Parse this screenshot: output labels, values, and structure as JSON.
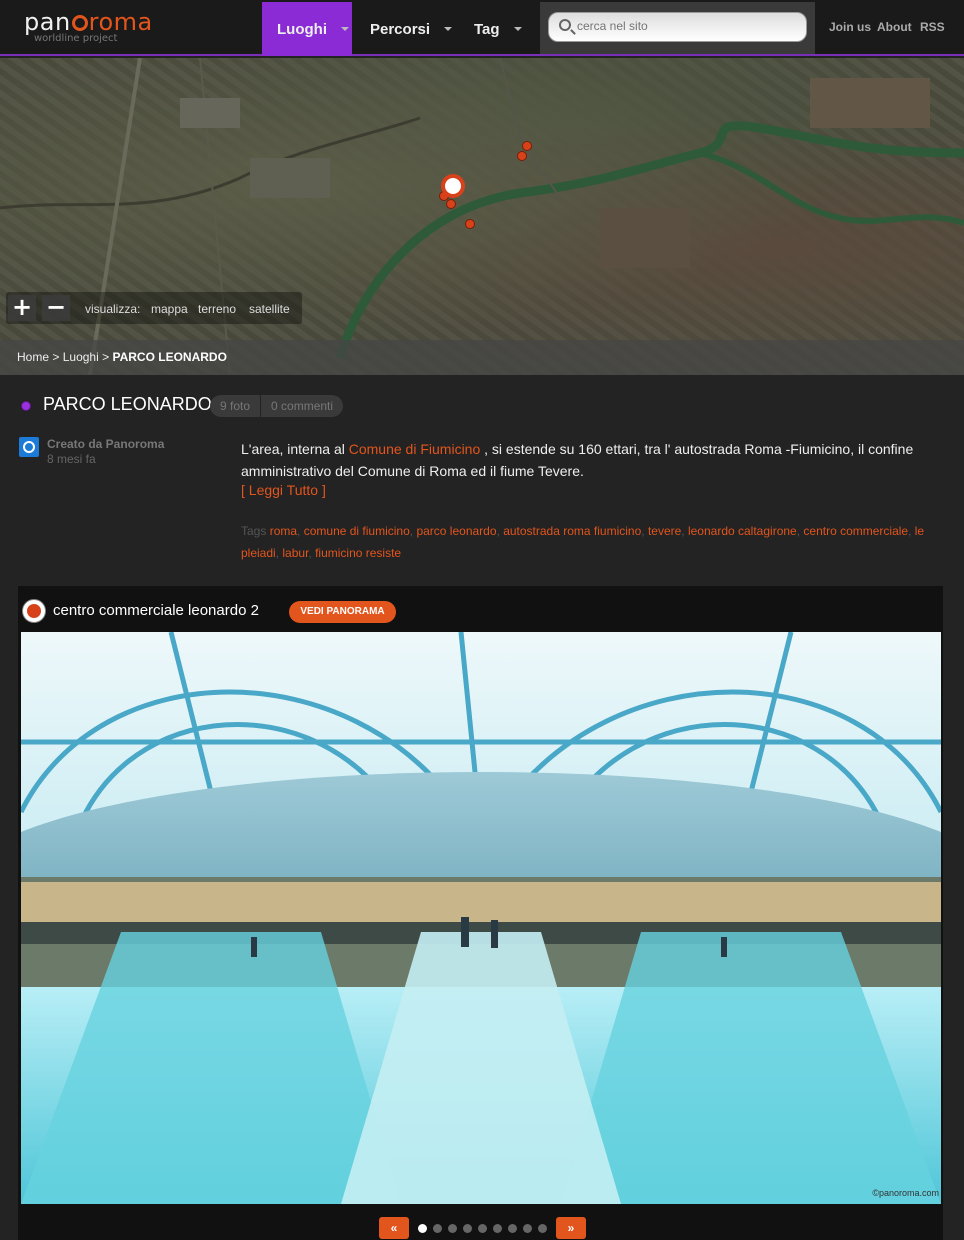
{
  "header": {
    "logo_pano": "pan",
    "logo_roma": "roma",
    "logo_sub": "worldline project",
    "nav": [
      {
        "label": "Luoghi"
      },
      {
        "label": "Percorsi"
      },
      {
        "label": "Tag"
      }
    ],
    "search_placeholder": "cerca nel sito",
    "links": [
      "Join us",
      "About",
      "RSS"
    ]
  },
  "map": {
    "zoom_in": "+",
    "zoom_out": "−",
    "view_label": "visualizza:",
    "view_options": [
      "mappa",
      "terreno",
      "satellite"
    ]
  },
  "breadcrumb": {
    "home": "Home",
    "sep": ">",
    "section": "Luoghi",
    "current": "PARCO LEONARDO"
  },
  "place": {
    "title": "PARCO LEONARDO",
    "photos": "9 foto",
    "comments": "0 commenti",
    "author": "Creato da Panoroma",
    "time": "8 mesi fa",
    "desc_before": "L'area, interna al ",
    "desc_link": "Comune di Fiumicino",
    "desc_after": " , si estende su 160 ettari, tra l' autostrada Roma -Fiumicino, il confine amministrativo del Comune di Roma ed  il fiume Tevere.",
    "read_more": "[ Leggi Tutto ]",
    "tags_label": "Tags",
    "tags": [
      "roma",
      "comune di fiumicino",
      "parco leonardo",
      "autostrada roma fiumicino",
      "tevere",
      "leonardo caltagirone",
      "centro commerciale",
      "le pleiadi",
      "labur",
      "fiumicino resiste"
    ]
  },
  "panorama": {
    "title": "centro commerciale leonardo 2",
    "button": "VEDI PANORAMA",
    "credit": "©panoroma.com",
    "prev": "«",
    "next": "»",
    "pages": 9,
    "current_page": 1
  },
  "colors": {
    "accent": "#e2551d",
    "nav_active": "#8a2bd6"
  }
}
